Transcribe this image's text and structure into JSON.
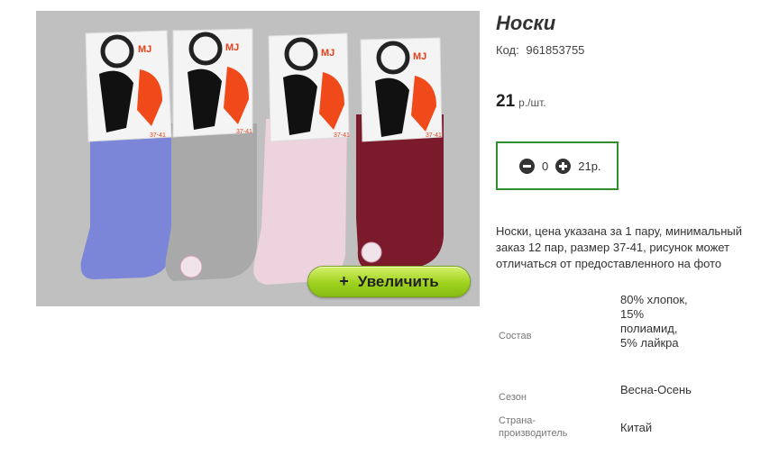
{
  "product": {
    "title": "Носки",
    "sku_label": "Код:",
    "sku": "961853755",
    "price": "21",
    "price_unit": "р./шт.",
    "quantity": "0",
    "total": "21р.",
    "description": "Носки, цена указана за 1 пару, минимальный заказ 12 пар, размер 37-41, рисунок может отличаться от предоставленного на фото",
    "zoom_label": "Увеличить",
    "zoom_plus": "+"
  },
  "packaging": {
    "brand": "MJ",
    "size_text": "37-41"
  },
  "specs": [
    {
      "label": "Состав",
      "value": "80% хлопок, 15% полиамид, 5% лайкра"
    },
    {
      "label": "Сезон",
      "value": "Весна-Осень"
    },
    {
      "label": "Страна-производитель",
      "value": "Китай"
    }
  ],
  "colors": {
    "accent_green": "#2f8f2f",
    "button_green": "#9fd21e",
    "sock_blue": "#7b86d9",
    "sock_gray": "#a9a9a9",
    "sock_pink": "#ecd3dd",
    "sock_burgundy": "#7a1a2a"
  }
}
